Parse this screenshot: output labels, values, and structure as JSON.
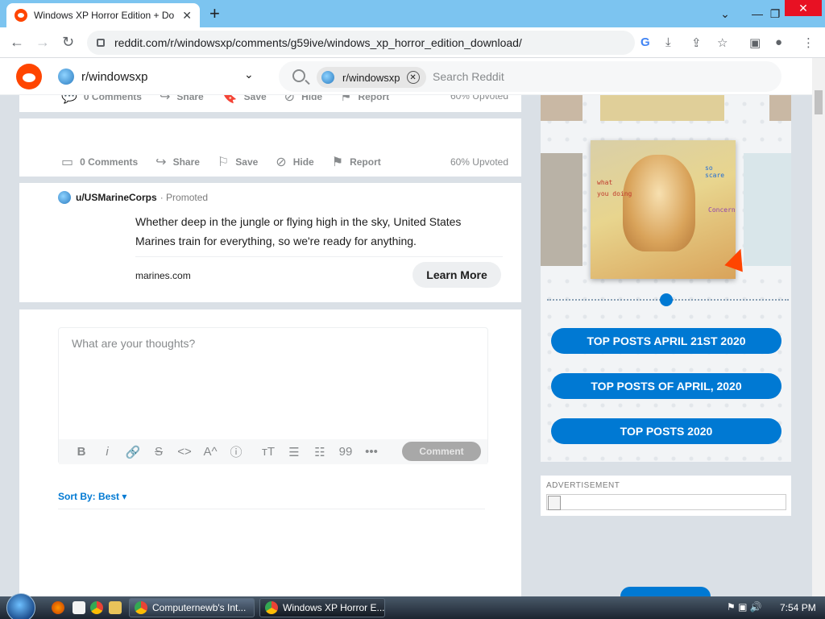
{
  "browser": {
    "tab_title": "Windows XP Horror Edition + Do",
    "tab_close": "✕",
    "new_tab": "+",
    "url": "reddit.com/r/windowsxp/comments/g59ive/windows_xp_horror_edition_download/",
    "window_controls": [
      "⌄",
      "—",
      "❐",
      "✕"
    ]
  },
  "reddit_header": {
    "subreddit": "r/windowsxp",
    "search_chip": "r/windowsxp",
    "search_placeholder": "Search Reddit"
  },
  "post_actions": {
    "comments": "0 Comments",
    "share": "Share",
    "save": "Save",
    "hide": "Hide",
    "report": "Report",
    "upvoted": "60% Upvoted"
  },
  "promoted": {
    "user": "u/USMarineCorps",
    "tag": "Promoted",
    "text": "Whether deep in the jungle or flying high in the sky, United States Marines train for everything, so we're ready for anything.",
    "domain": "marines.com",
    "cta": "Learn More"
  },
  "comment_box": {
    "placeholder": "What are your thoughts?",
    "submit": "Comment",
    "toolbar": [
      "B",
      "i",
      "🔗",
      "S",
      "<>",
      "A^",
      "ⓘ",
      "тT",
      "☰",
      "☷",
      "99",
      "•••"
    ]
  },
  "sort": {
    "label": "Sort By: Best"
  },
  "sidebar": {
    "meme_text": [
      "what",
      "you doing",
      "so scare",
      "Concern"
    ],
    "buttons": [
      "TOP POSTS APRIL 21ST 2020",
      "TOP POSTS OF APRIL, 2020",
      "TOP POSTS 2020"
    ],
    "ad_label": "ADVERTISEMENT"
  },
  "taskbar": {
    "tasks": [
      "Computernewb's Int...",
      "Windows XP Horror E..."
    ],
    "clock": "7:54 PM"
  },
  "colors": {
    "reddit_orange": "#ff4500",
    "reddit_blue": "#0079d3",
    "tab_strip": "#7cc4f0"
  }
}
